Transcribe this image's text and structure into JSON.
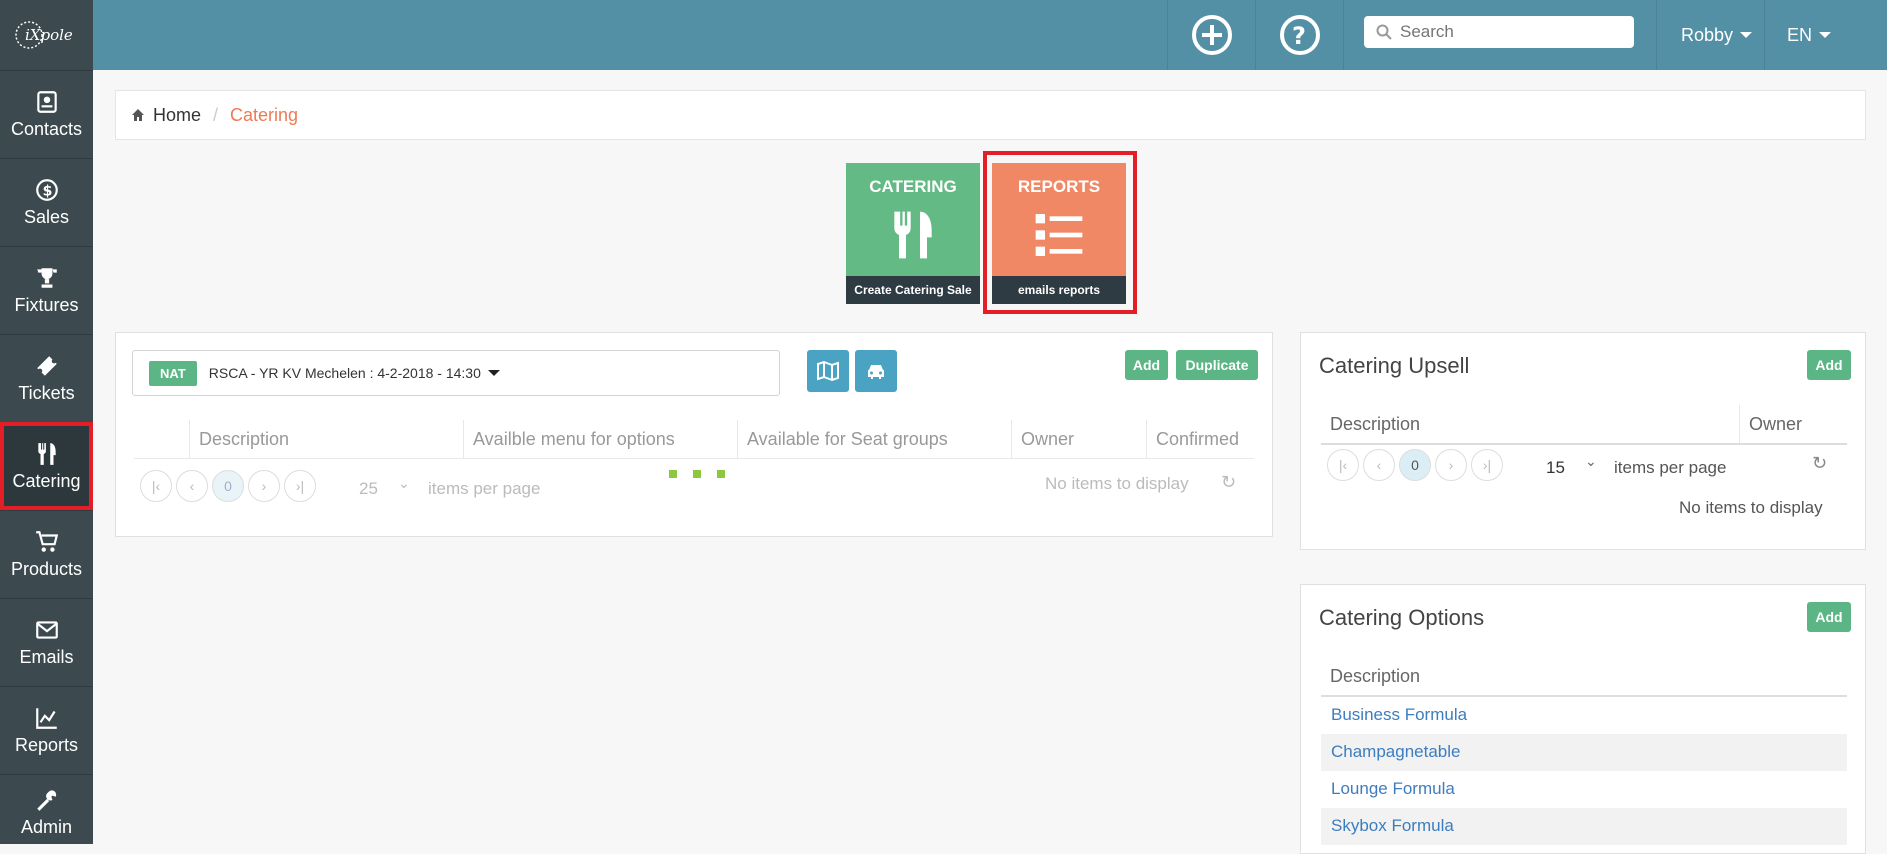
{
  "app": {
    "logo_text": "iXpole"
  },
  "sidebar": {
    "items": [
      {
        "label": "Contacts"
      },
      {
        "label": "Sales"
      },
      {
        "label": "Fixtures"
      },
      {
        "label": "Tickets"
      },
      {
        "label": "Catering"
      },
      {
        "label": "Products"
      },
      {
        "label": "Emails"
      },
      {
        "label": "Reports"
      },
      {
        "label": "Admin"
      }
    ],
    "active": "Catering"
  },
  "topbar": {
    "search_placeholder": "Search",
    "user": "Robby",
    "lang": "EN"
  },
  "breadcrumb": {
    "home": "Home",
    "separator": "/",
    "current": "Catering"
  },
  "tiles": [
    {
      "title": "CATERING",
      "footer": "Create Catering Sale",
      "color": "#63ba84"
    },
    {
      "title": "REPORTS",
      "footer": "emails reports",
      "color": "#f08866"
    }
  ],
  "main": {
    "fixture_badge": "NAT",
    "fixture_label": "RSCA - YR KV Mechelen : 4-2-2018 - 14:30",
    "add_label": "Add",
    "duplicate_label": "Duplicate",
    "columns": [
      "Description",
      "Availble menu for options",
      "Available for Seat groups",
      "Owner",
      "Confirmed"
    ],
    "page": "0",
    "page_size": "25",
    "items_per_page": "items per page",
    "no_items": "No items to display"
  },
  "upsell": {
    "title": "Catering Upsell",
    "add_label": "Add",
    "columns": [
      "Description",
      "Owner"
    ],
    "page": "0",
    "page_size": "15",
    "items_per_page": "items per page",
    "no_items": "No items to display"
  },
  "options": {
    "title": "Catering Options",
    "add_label": "Add",
    "column": "Description",
    "rows": [
      "Business Formula",
      "Champagnetable",
      "Lounge Formula",
      "Skybox Formula"
    ]
  },
  "colors": {
    "accent": "#5390a6",
    "green": "#5cb585",
    "orange": "#f08866",
    "highlight": "#e41e26"
  }
}
